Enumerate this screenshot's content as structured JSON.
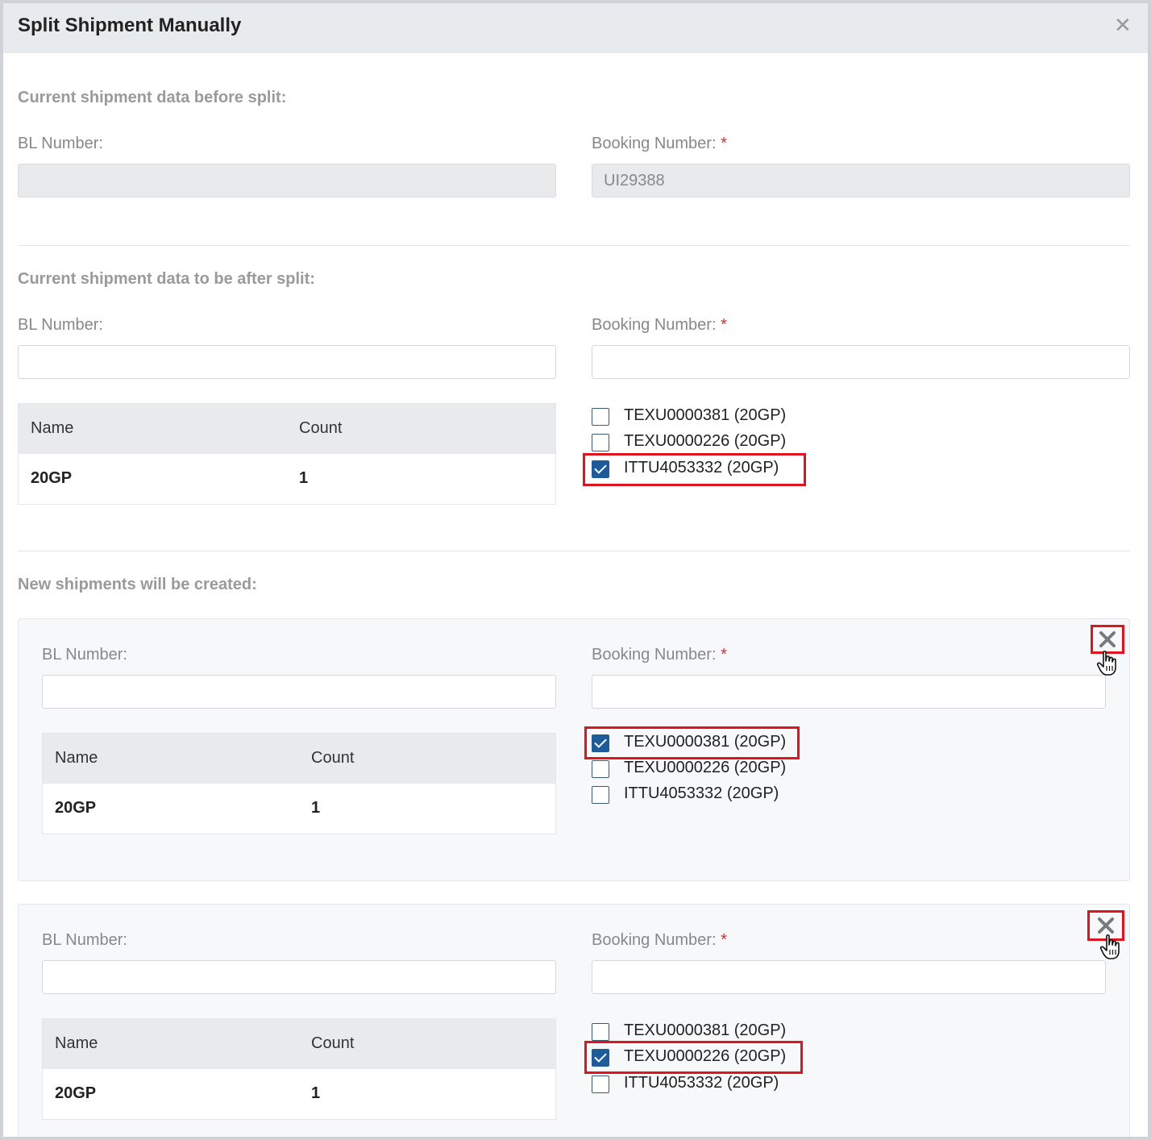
{
  "dialog": {
    "title": "Split Shipment Manually",
    "close_icon": "close-icon"
  },
  "labels": {
    "bl_number": "BL Number:",
    "booking_number": "Booking Number:",
    "required_mark": "*"
  },
  "table_headers": {
    "name": "Name",
    "count": "Count"
  },
  "before": {
    "title": "Current shipment data before split:",
    "bl_value": "",
    "booking_value": "UI29388"
  },
  "after": {
    "title": "Current shipment data to be after split:",
    "bl_value": "",
    "booking_value": "",
    "rows": [
      {
        "name": "20GP",
        "count": "1"
      }
    ],
    "containers": [
      {
        "label": "TEXU0000381 (20GP)",
        "checked": false
      },
      {
        "label": "TEXU0000226 (20GP)",
        "checked": false
      },
      {
        "label": "ITTU4053332 (20GP)",
        "checked": true
      }
    ]
  },
  "new_shipments": {
    "title": "New shipments will be created:",
    "items": [
      {
        "bl_value": "",
        "booking_value": "",
        "rows": [
          {
            "name": "20GP",
            "count": "1"
          }
        ],
        "containers": [
          {
            "label": "TEXU0000381 (20GP)",
            "checked": true
          },
          {
            "label": "TEXU0000226 (20GP)",
            "checked": false
          },
          {
            "label": "ITTU4053332 (20GP)",
            "checked": false
          }
        ]
      },
      {
        "bl_value": "",
        "booking_value": "",
        "rows": [
          {
            "name": "20GP",
            "count": "1"
          }
        ],
        "containers": [
          {
            "label": "TEXU0000381 (20GP)",
            "checked": false
          },
          {
            "label": "TEXU0000226 (20GP)",
            "checked": true
          },
          {
            "label": "ITTU4053332 (20GP)",
            "checked": false
          }
        ]
      }
    ]
  },
  "colors": {
    "accent": "#1d5b9a",
    "highlight": "#e0141e",
    "required": "#d32f2f"
  }
}
